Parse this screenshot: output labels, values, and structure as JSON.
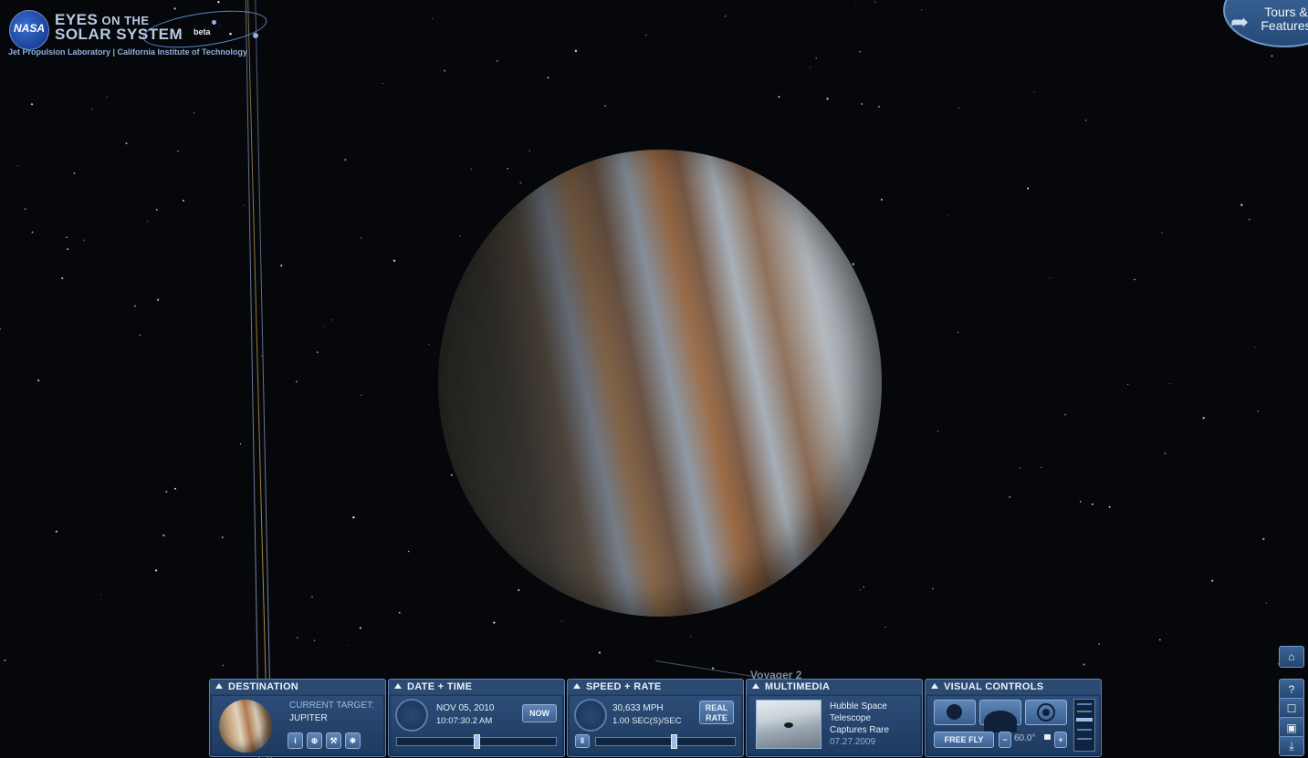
{
  "logo": {
    "badge": "NASA",
    "line1_a": "EYES",
    "line1_b": " ON THE",
    "line2": "SOLAR SYSTEM",
    "beta": "beta",
    "org": "Jet Propulsion Laboratory | California Institute of Technology"
  },
  "tours": {
    "line1": "Tours &",
    "line2": "Features"
  },
  "scene": {
    "spacecraft_label": "Voyager 2",
    "planet": "Jupiter"
  },
  "panels": {
    "destination": {
      "title": "DESTINATION",
      "current_target_label": "CURRENT TARGET:",
      "current_target": "JUPITER",
      "buttons": [
        "i",
        "⊕",
        "⚒",
        "✵"
      ]
    },
    "datetime": {
      "title": "DATE + TIME",
      "date": "NOV 05, 2010",
      "time": "10:07:30.2 AM",
      "now_button": "NOW"
    },
    "speed": {
      "title": "SPEED + RATE",
      "speed": "30,633 MPH",
      "rate": "1.00 SEC(S)/SEC",
      "real_rate_l1": "REAL",
      "real_rate_l2": "RATE",
      "pause": "‖"
    },
    "multimedia": {
      "title": "MULTIMEDIA",
      "line1": "Hubble Space",
      "line2": "Telescope",
      "line3": "Captures Rare",
      "date": "07.27.2009"
    },
    "visual": {
      "title": "VISUAL CONTROLS",
      "free_fly": "FREE FLY",
      "minus": "−",
      "fov": "60.0°",
      "plus": "+"
    }
  },
  "right_controls": {
    "home": "⌂",
    "help": "?",
    "fullscreen": "☐",
    "camera": "▣",
    "download": "⤓"
  },
  "colors": {
    "panel": "#1f3858",
    "accent": "#5b83b5",
    "sky": "#05070b"
  }
}
